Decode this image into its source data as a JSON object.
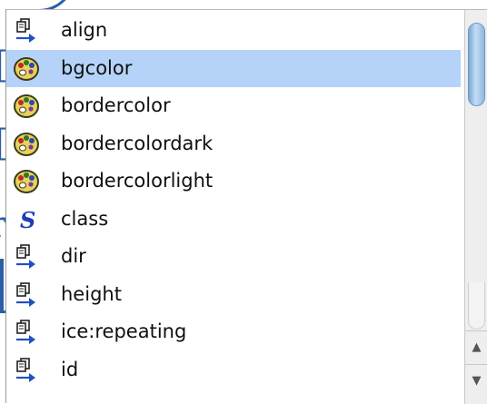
{
  "list": {
    "items": [
      {
        "label": "align",
        "icon": "page-arrow-icon",
        "selected": false
      },
      {
        "label": "bgcolor",
        "icon": "palette-icon",
        "selected": true
      },
      {
        "label": "bordercolor",
        "icon": "palette-icon",
        "selected": false
      },
      {
        "label": "bordercolordark",
        "icon": "palette-icon",
        "selected": false
      },
      {
        "label": "bordercolorlight",
        "icon": "palette-icon",
        "selected": false
      },
      {
        "label": "class",
        "icon": "style-s-icon",
        "selected": false
      },
      {
        "label": "dir",
        "icon": "page-arrow-icon",
        "selected": false
      },
      {
        "label": "height",
        "icon": "page-arrow-icon",
        "selected": false
      },
      {
        "label": "ice:repeating",
        "icon": "page-arrow-icon",
        "selected": false
      },
      {
        "label": "id",
        "icon": "page-arrow-icon",
        "selected": false
      }
    ]
  },
  "scrollbar": {
    "up_arrow": "▲",
    "down_arrow": "▼"
  },
  "colors": {
    "selection": "#b5d3f8",
    "background_editor_text": "#2a5fa8"
  }
}
